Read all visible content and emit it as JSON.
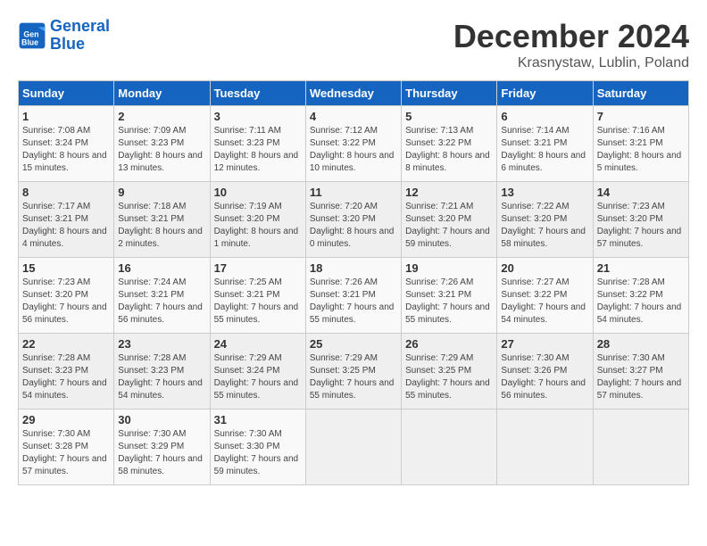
{
  "header": {
    "logo_line1": "General",
    "logo_line2": "Blue",
    "month": "December 2024",
    "location": "Krasnystaw, Lublin, Poland"
  },
  "weekdays": [
    "Sunday",
    "Monday",
    "Tuesday",
    "Wednesday",
    "Thursday",
    "Friday",
    "Saturday"
  ],
  "weeks": [
    [
      {
        "day": "1",
        "sunrise": "Sunrise: 7:08 AM",
        "sunset": "Sunset: 3:24 PM",
        "daylight": "Daylight: 8 hours and 15 minutes."
      },
      {
        "day": "2",
        "sunrise": "Sunrise: 7:09 AM",
        "sunset": "Sunset: 3:23 PM",
        "daylight": "Daylight: 8 hours and 13 minutes."
      },
      {
        "day": "3",
        "sunrise": "Sunrise: 7:11 AM",
        "sunset": "Sunset: 3:23 PM",
        "daylight": "Daylight: 8 hours and 12 minutes."
      },
      {
        "day": "4",
        "sunrise": "Sunrise: 7:12 AM",
        "sunset": "Sunset: 3:22 PM",
        "daylight": "Daylight: 8 hours and 10 minutes."
      },
      {
        "day": "5",
        "sunrise": "Sunrise: 7:13 AM",
        "sunset": "Sunset: 3:22 PM",
        "daylight": "Daylight: 8 hours and 8 minutes."
      },
      {
        "day": "6",
        "sunrise": "Sunrise: 7:14 AM",
        "sunset": "Sunset: 3:21 PM",
        "daylight": "Daylight: 8 hours and 6 minutes."
      },
      {
        "day": "7",
        "sunrise": "Sunrise: 7:16 AM",
        "sunset": "Sunset: 3:21 PM",
        "daylight": "Daylight: 8 hours and 5 minutes."
      }
    ],
    [
      {
        "day": "8",
        "sunrise": "Sunrise: 7:17 AM",
        "sunset": "Sunset: 3:21 PM",
        "daylight": "Daylight: 8 hours and 4 minutes."
      },
      {
        "day": "9",
        "sunrise": "Sunrise: 7:18 AM",
        "sunset": "Sunset: 3:21 PM",
        "daylight": "Daylight: 8 hours and 2 minutes."
      },
      {
        "day": "10",
        "sunrise": "Sunrise: 7:19 AM",
        "sunset": "Sunset: 3:20 PM",
        "daylight": "Daylight: 8 hours and 1 minute."
      },
      {
        "day": "11",
        "sunrise": "Sunrise: 7:20 AM",
        "sunset": "Sunset: 3:20 PM",
        "daylight": "Daylight: 8 hours and 0 minutes."
      },
      {
        "day": "12",
        "sunrise": "Sunrise: 7:21 AM",
        "sunset": "Sunset: 3:20 PM",
        "daylight": "Daylight: 7 hours and 59 minutes."
      },
      {
        "day": "13",
        "sunrise": "Sunrise: 7:22 AM",
        "sunset": "Sunset: 3:20 PM",
        "daylight": "Daylight: 7 hours and 58 minutes."
      },
      {
        "day": "14",
        "sunrise": "Sunrise: 7:23 AM",
        "sunset": "Sunset: 3:20 PM",
        "daylight": "Daylight: 7 hours and 57 minutes."
      }
    ],
    [
      {
        "day": "15",
        "sunrise": "Sunrise: 7:23 AM",
        "sunset": "Sunset: 3:20 PM",
        "daylight": "Daylight: 7 hours and 56 minutes."
      },
      {
        "day": "16",
        "sunrise": "Sunrise: 7:24 AM",
        "sunset": "Sunset: 3:21 PM",
        "daylight": "Daylight: 7 hours and 56 minutes."
      },
      {
        "day": "17",
        "sunrise": "Sunrise: 7:25 AM",
        "sunset": "Sunset: 3:21 PM",
        "daylight": "Daylight: 7 hours and 55 minutes."
      },
      {
        "day": "18",
        "sunrise": "Sunrise: 7:26 AM",
        "sunset": "Sunset: 3:21 PM",
        "daylight": "Daylight: 7 hours and 55 minutes."
      },
      {
        "day": "19",
        "sunrise": "Sunrise: 7:26 AM",
        "sunset": "Sunset: 3:21 PM",
        "daylight": "Daylight: 7 hours and 55 minutes."
      },
      {
        "day": "20",
        "sunrise": "Sunrise: 7:27 AM",
        "sunset": "Sunset: 3:22 PM",
        "daylight": "Daylight: 7 hours and 54 minutes."
      },
      {
        "day": "21",
        "sunrise": "Sunrise: 7:28 AM",
        "sunset": "Sunset: 3:22 PM",
        "daylight": "Daylight: 7 hours and 54 minutes."
      }
    ],
    [
      {
        "day": "22",
        "sunrise": "Sunrise: 7:28 AM",
        "sunset": "Sunset: 3:23 PM",
        "daylight": "Daylight: 7 hours and 54 minutes."
      },
      {
        "day": "23",
        "sunrise": "Sunrise: 7:28 AM",
        "sunset": "Sunset: 3:23 PM",
        "daylight": "Daylight: 7 hours and 54 minutes."
      },
      {
        "day": "24",
        "sunrise": "Sunrise: 7:29 AM",
        "sunset": "Sunset: 3:24 PM",
        "daylight": "Daylight: 7 hours and 55 minutes."
      },
      {
        "day": "25",
        "sunrise": "Sunrise: 7:29 AM",
        "sunset": "Sunset: 3:25 PM",
        "daylight": "Daylight: 7 hours and 55 minutes."
      },
      {
        "day": "26",
        "sunrise": "Sunrise: 7:29 AM",
        "sunset": "Sunset: 3:25 PM",
        "daylight": "Daylight: 7 hours and 55 minutes."
      },
      {
        "day": "27",
        "sunrise": "Sunrise: 7:30 AM",
        "sunset": "Sunset: 3:26 PM",
        "daylight": "Daylight: 7 hours and 56 minutes."
      },
      {
        "day": "28",
        "sunrise": "Sunrise: 7:30 AM",
        "sunset": "Sunset: 3:27 PM",
        "daylight": "Daylight: 7 hours and 57 minutes."
      }
    ],
    [
      {
        "day": "29",
        "sunrise": "Sunrise: 7:30 AM",
        "sunset": "Sunset: 3:28 PM",
        "daylight": "Daylight: 7 hours and 57 minutes."
      },
      {
        "day": "30",
        "sunrise": "Sunrise: 7:30 AM",
        "sunset": "Sunset: 3:29 PM",
        "daylight": "Daylight: 7 hours and 58 minutes."
      },
      {
        "day": "31",
        "sunrise": "Sunrise: 7:30 AM",
        "sunset": "Sunset: 3:30 PM",
        "daylight": "Daylight: 7 hours and 59 minutes."
      },
      null,
      null,
      null,
      null
    ]
  ]
}
